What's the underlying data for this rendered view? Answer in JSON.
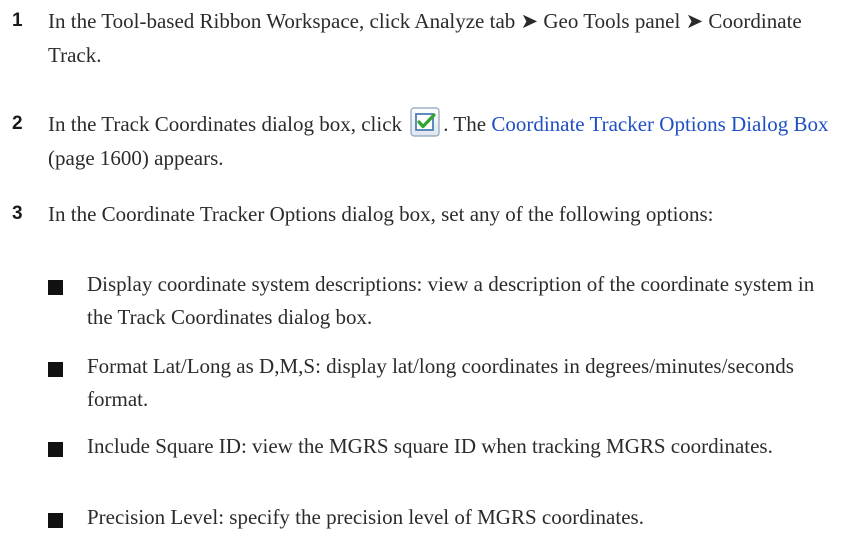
{
  "steps": [
    {
      "number": "1",
      "text": "In the Tool-based Ribbon Workspace, click Analyze tab ➤ Geo Tools panel ➤ Coordinate Track."
    },
    {
      "number": "2",
      "text_before_icon": "In the Track Coordinates dialog box, click",
      "icon": "options-checkbox-icon",
      "text_after_icon": ". The",
      "link": "Coordinate Tracker Options Dialog Box",
      "text_end": "(page 1600) appears."
    },
    {
      "number": "3",
      "text": "In the Coordinate Tracker Options dialog box, set any of the following options:"
    }
  ],
  "options": [
    "Display coordinate system descriptions: view a description of the coordinate system in the Track Coordinates dialog box.",
    "Format Lat/Long as D,M,S: display lat/long coordinates in degrees/minutes/seconds format.",
    "Include Square ID: view the MGRS square ID when tracking MGRS coordinates.",
    "Precision Level: specify the precision level of MGRS coordinates."
  ],
  "colors": {
    "link": "#1f4fc4",
    "icon_border": "#4f7fb5",
    "icon_check": "#2fa52f"
  }
}
